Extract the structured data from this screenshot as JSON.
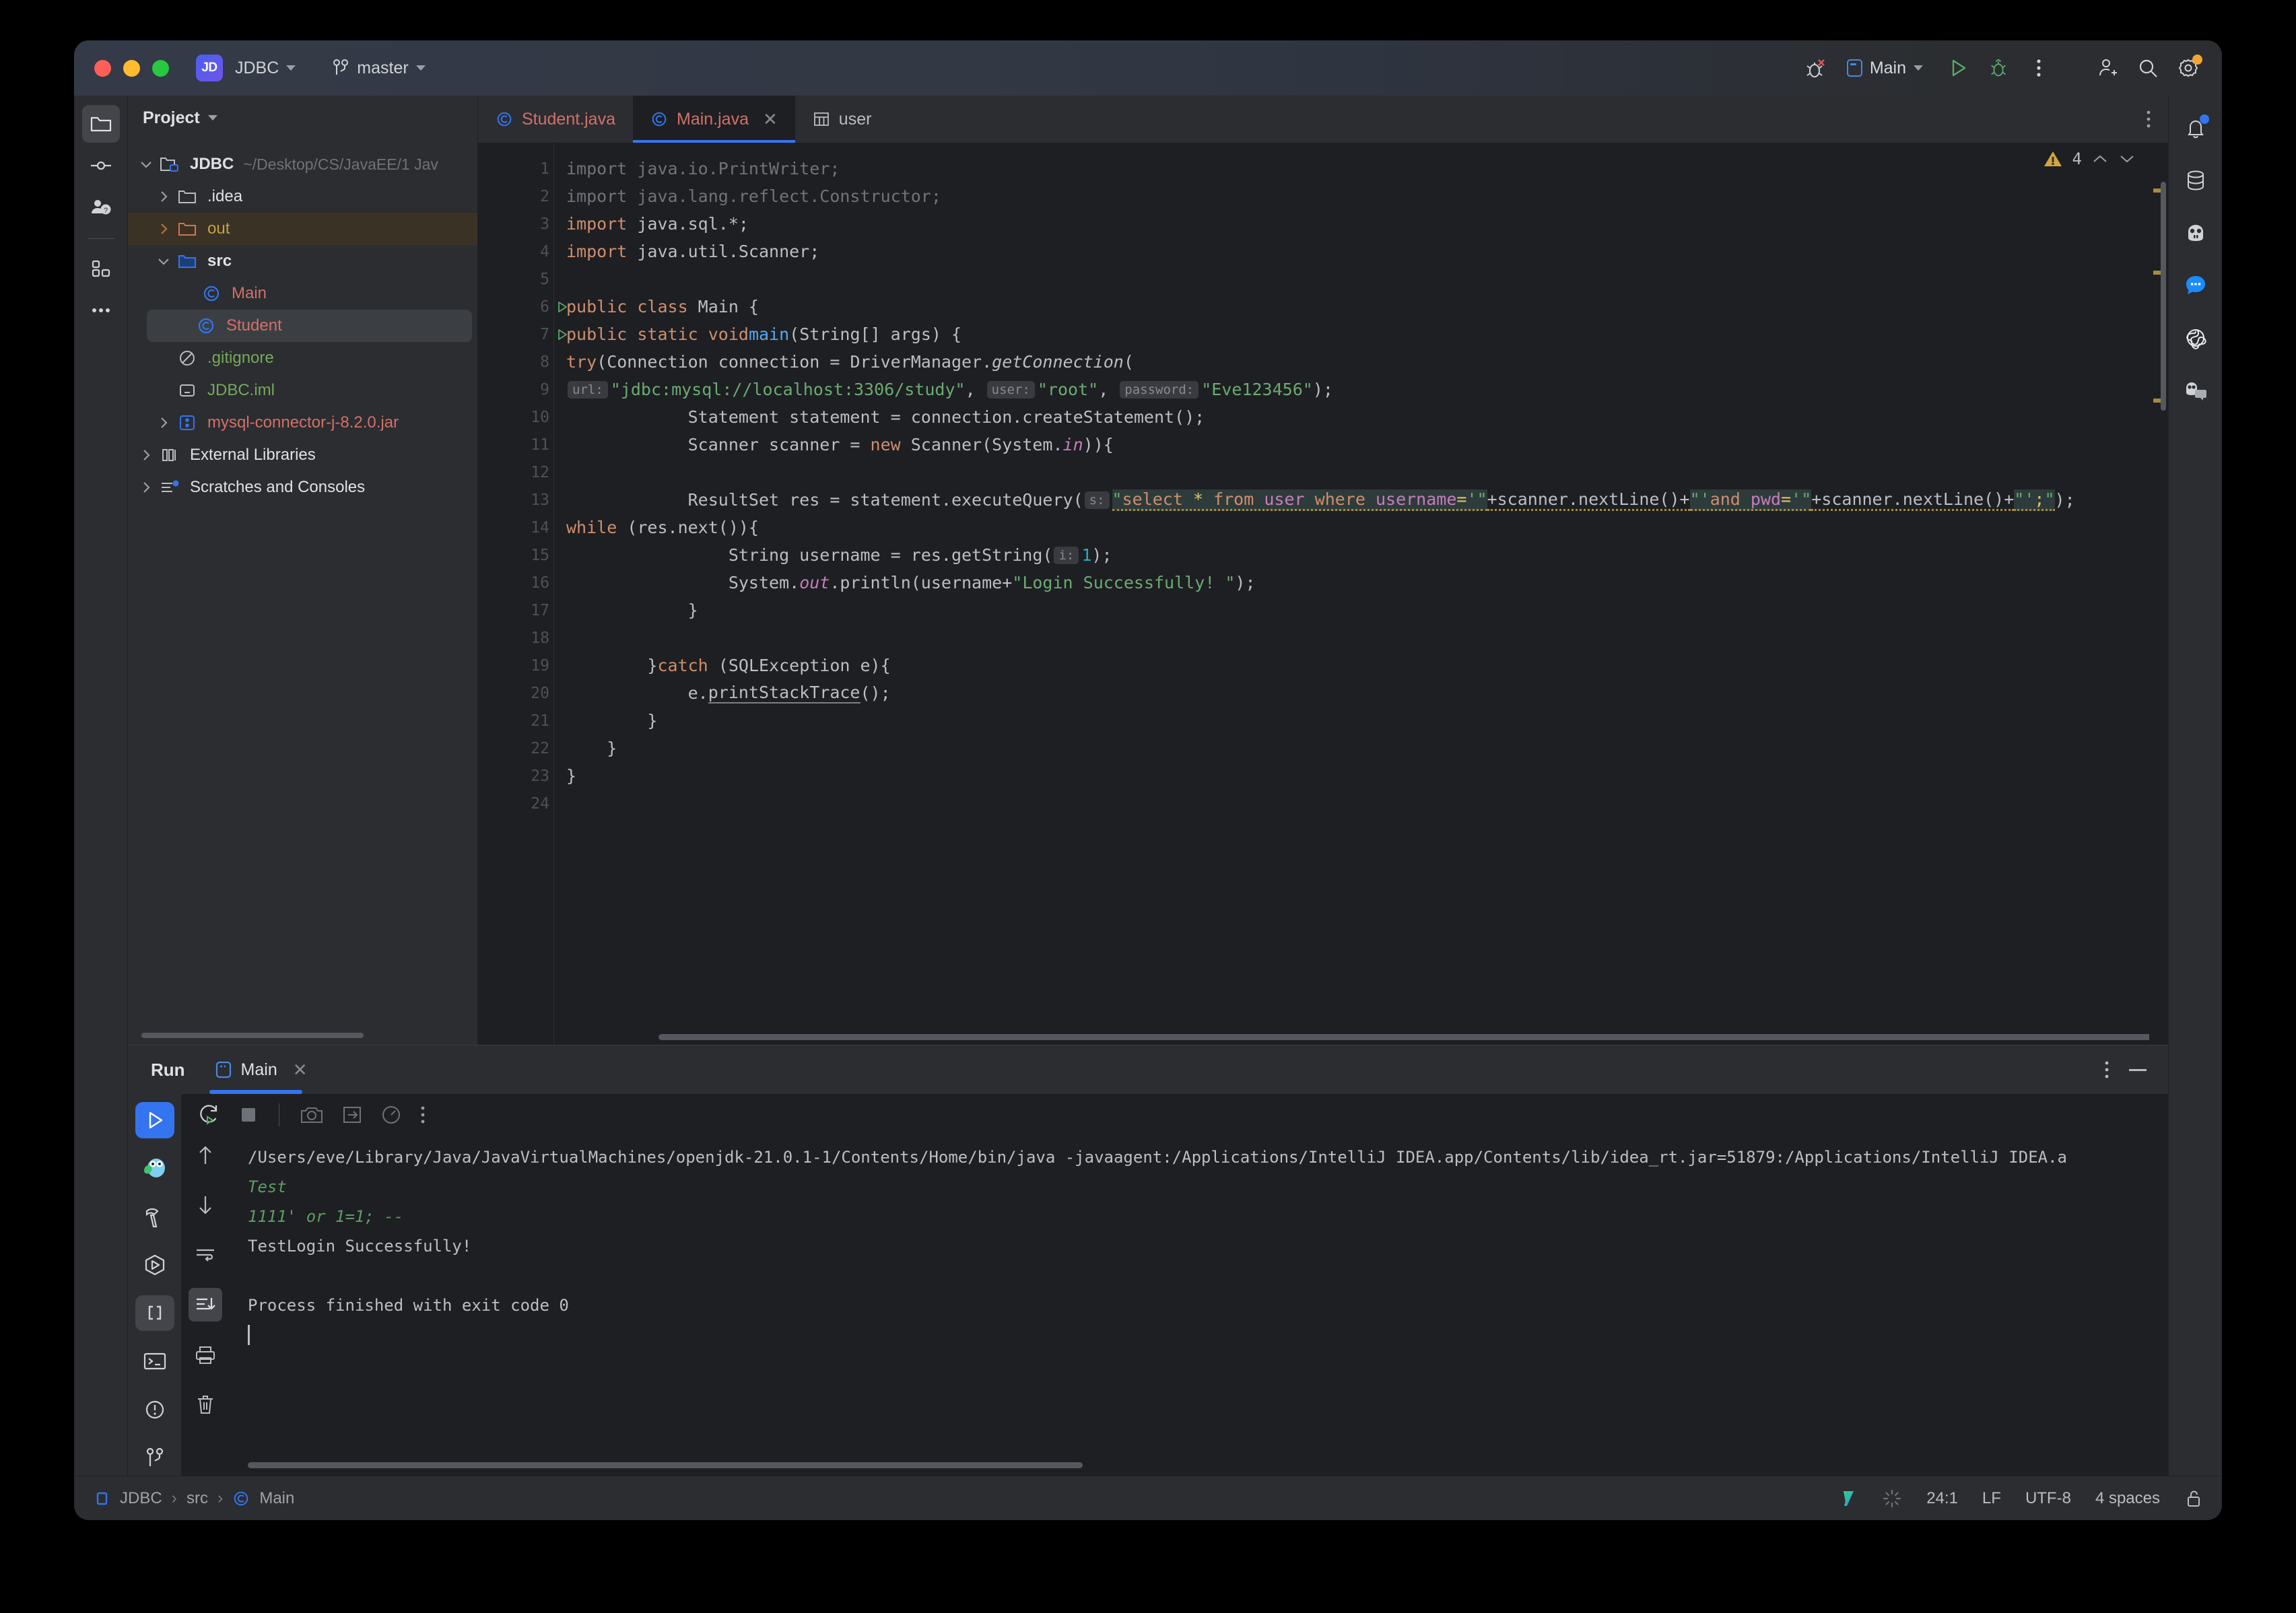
{
  "titlebar": {
    "project_badge": "JD",
    "project_name": "JDBC",
    "branch": "master",
    "run_config": "Main",
    "icons": {
      "debug_x": "debug-disabled-icon",
      "run": "run-icon",
      "debug": "debug-icon",
      "more": "more-vertical-icon",
      "add_user": "add-user-icon",
      "search": "search-icon",
      "settings": "settings-icon"
    }
  },
  "left_rail": [
    {
      "name": "project-tool-window",
      "icon": "folder-icon",
      "active": true
    },
    {
      "name": "commit-tool-window",
      "icon": "commit-icon",
      "active": false
    },
    {
      "name": "pull-requests-tool-window",
      "icon": "pull-request-icon",
      "active": false
    },
    {
      "name": "structure-tool-window",
      "icon": "structure-icon",
      "active": false
    },
    {
      "name": "more-tool-windows",
      "icon": "more-horizontal-icon",
      "active": false
    }
  ],
  "right_rail": [
    {
      "name": "notifications",
      "icon": "bell-icon"
    },
    {
      "name": "database",
      "icon": "database-icon"
    },
    {
      "name": "ai-assistant",
      "icon": "ai-robot-icon"
    },
    {
      "name": "chat",
      "icon": "chat-bubble-icon"
    },
    {
      "name": "openai-plugin",
      "icon": "openai-icon"
    },
    {
      "name": "code-with-me",
      "icon": "code-with-me-icon"
    }
  ],
  "project_panel": {
    "title": "Project",
    "tree": [
      {
        "label": "JDBC",
        "path": "~/Desktop/CS/JavaEE/1 Jav",
        "icon": "project-folder-icon",
        "indent": 0,
        "expanded": true,
        "style": "bold"
      },
      {
        "label": ".idea",
        "path": "",
        "icon": "folder-icon",
        "indent": 1,
        "expanded": false,
        "style": "plain"
      },
      {
        "label": "out",
        "path": "",
        "icon": "folder-excluded-icon",
        "indent": 1,
        "expanded": false,
        "style": "yellow",
        "highlight": "out"
      },
      {
        "label": "src",
        "path": "",
        "icon": "source-folder-icon",
        "indent": 1,
        "expanded": true,
        "style": "bold"
      },
      {
        "label": "Main",
        "path": "",
        "icon": "java-class-icon",
        "indent": 2,
        "expanded": null,
        "style": "red"
      },
      {
        "label": "Student",
        "path": "",
        "icon": "java-class-icon",
        "indent": 2,
        "expanded": null,
        "style": "red",
        "selected": true
      },
      {
        "label": ".gitignore",
        "path": "",
        "icon": "gitignore-icon",
        "indent": 1,
        "expanded": null,
        "style": "green"
      },
      {
        "label": "JDBC.iml",
        "path": "",
        "icon": "iml-file-icon",
        "indent": 1,
        "expanded": null,
        "style": "green"
      },
      {
        "label": "mysql-connector-j-8.2.0.jar",
        "path": "",
        "icon": "jar-icon",
        "indent": 1,
        "expanded": false,
        "style": "red"
      },
      {
        "label": "External Libraries",
        "path": "",
        "icon": "libraries-icon",
        "indent": 0,
        "expanded": false,
        "style": "plain"
      },
      {
        "label": "Scratches and Consoles",
        "path": "",
        "icon": "scratches-icon",
        "indent": 0,
        "expanded": false,
        "style": "plain"
      }
    ]
  },
  "editor": {
    "tabs": [
      {
        "label": "Student.java",
        "icon": "java-class-icon",
        "active": false,
        "closable": false
      },
      {
        "label": "Main.java",
        "icon": "java-class-icon",
        "active": true,
        "closable": true
      },
      {
        "label": "user",
        "icon": "table-icon",
        "active": false,
        "closable": false
      }
    ],
    "inspections": {
      "warning_count": "4",
      "icon": "warning-triangle-icon"
    },
    "line_numbers": [
      "1",
      "2",
      "3",
      "4",
      "5",
      "6",
      "7",
      "8",
      "9",
      "10",
      "11",
      "12",
      "13",
      "14",
      "15",
      "16",
      "17",
      "18",
      "19",
      "20",
      "21",
      "22",
      "23",
      "24"
    ],
    "code_lines": [
      "import java.io.PrintWriter;",
      "import java.lang.reflect.Constructor;",
      "import java.sql.*;",
      "import java.util.Scanner;",
      "",
      "public class Main {",
      "    public static void main(String[] args) {",
      "        try(Connection connection = DriverManager.getConnection(",
      "                url: \"jdbc:mysql://localhost:3306/study\", user: \"root\", password: \"Eve123456\");",
      "            Statement statement = connection.createStatement();",
      "            Scanner scanner = new Scanner(System.in)){",
      "",
      "            ResultSet res = statement.executeQuery( s: \"select * from user where username='\"+scanner.nextLine()+\"'and pwd='\"+scanner.nextLine()+\"';\");",
      "            while (res.next()){",
      "                String username = res.getString( i: 1);",
      "                System.out.println(username+\"Login Successfully! \");",
      "            }",
      "",
      "        }catch (SQLException e){",
      "            e.printStackTrace();",
      "        }",
      "    }",
      "}",
      ""
    ],
    "hints": {
      "url": "url:",
      "user": "user:",
      "password": "password:",
      "s": "s:",
      "i": "i:"
    },
    "values": {
      "jdbc_url": "\"jdbc:mysql://localhost:3306/study\"",
      "db_user": "\"root\"",
      "db_password": "\"Eve123456\"",
      "login_message": "\"Login Successfully! \"",
      "column_index": "1"
    }
  },
  "run_panel": {
    "title": "Run",
    "tab_label": "Main",
    "tab_icon": "run-config-icon",
    "close_icon": "close-icon",
    "more_icon": "more-vertical-icon",
    "minimize_icon": "minimize-icon",
    "rail": [
      {
        "name": "run",
        "icon": "run-icon",
        "active": true
      },
      {
        "name": "go-lang",
        "icon": "go-gopher-icon",
        "active": false
      },
      {
        "name": "build",
        "icon": "hammer-icon",
        "active": false
      },
      {
        "name": "services",
        "icon": "services-icon",
        "active": false
      },
      {
        "name": "endpoints",
        "icon": "brackets-icon",
        "active": false
      },
      {
        "name": "terminal",
        "icon": "terminal-icon",
        "active": false
      },
      {
        "name": "problems",
        "icon": "problems-icon",
        "active": false
      },
      {
        "name": "version-control",
        "icon": "branch-icon",
        "active": false
      }
    ],
    "toolbar": [
      {
        "name": "rerun",
        "icon": "rerun-icon"
      },
      {
        "name": "stop",
        "icon": "stop-icon"
      },
      {
        "name": "screenshot",
        "icon": "camera-icon"
      },
      {
        "name": "export",
        "icon": "export-icon"
      },
      {
        "name": "profiler",
        "icon": "gauge-icon"
      },
      {
        "name": "more",
        "icon": "more-vertical-icon"
      }
    ],
    "side_tools": [
      {
        "name": "up",
        "icon": "arrow-up-icon",
        "active": false
      },
      {
        "name": "down",
        "icon": "arrow-down-icon",
        "active": false
      },
      {
        "name": "soft-wrap",
        "icon": "wrap-icon",
        "active": false
      },
      {
        "name": "scroll-to-end",
        "icon": "scroll-end-icon",
        "active": true
      },
      {
        "name": "print",
        "icon": "printer-icon",
        "active": false
      },
      {
        "name": "clear-all",
        "icon": "trash-icon",
        "active": false
      }
    ],
    "console": [
      {
        "text": "/Users/eve/Library/Java/JavaVirtualMachines/openjdk-21.0.1-1/Contents/Home/bin/java -javaagent:/Applications/IntelliJ IDEA.app/Contents/lib/idea_rt.jar=51879:/Applications/IntelliJ IDEA.a",
        "style": "normal"
      },
      {
        "text": "Test",
        "style": "input"
      },
      {
        "text": "1111' or 1=1; --",
        "style": "input"
      },
      {
        "text": "TestLogin Successfully!",
        "style": "normal"
      },
      {
        "text": "",
        "style": "normal"
      },
      {
        "text": "Process finished with exit code 0",
        "style": "normal"
      }
    ]
  },
  "status_bar": {
    "breadcrumb": [
      "JDBC",
      "src",
      "Main"
    ],
    "breadcrumb_icons": [
      "module-icon",
      "",
      "java-class-icon"
    ],
    "separator": "›",
    "right": {
      "validation_icon": "validation-check-icon",
      "indexing_icon": "indexing-spinner-icon",
      "caret_position": "24:1",
      "line_separator": "LF",
      "encoding": "UTF-8",
      "indent": "4 spaces",
      "lock_icon": "unlocked-icon"
    }
  },
  "colors": {
    "accent_blue": "#3574f0",
    "window_bg": "#2b2d30",
    "editor_bg": "#1e1f22",
    "string_green": "#6aab73",
    "keyword_orange": "#cf8e6d",
    "warning_amber": "#a98b3d",
    "class_red": "#d2706a"
  }
}
